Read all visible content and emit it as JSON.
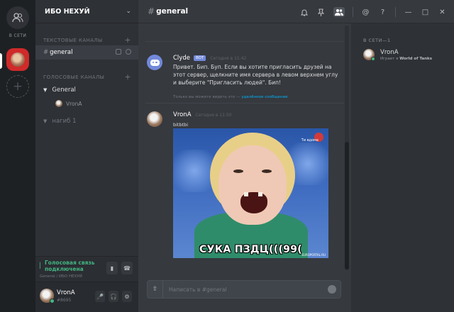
{
  "rail": {
    "online_label": "В СЕТИ",
    "add_label": "+"
  },
  "server": {
    "name": "ИБО НЕХУЙ",
    "text_category": "ТЕКСТОВЫЕ КАНАЛЫ",
    "voice_category": "ГОЛОСОВЫЕ КАНАЛЫ",
    "text_channel": "general",
    "voice_channels": [
      {
        "name": "General",
        "users": [
          "VronA"
        ]
      },
      {
        "name": "нагиб 1"
      }
    ]
  },
  "voice_panel": {
    "status": "Голосовая связь подключена",
    "location": "General / ИБО НЕХУЙ"
  },
  "user": {
    "name": "VronA",
    "tag": "#8695"
  },
  "chat": {
    "channel": "general",
    "placeholder": "Написать в #general",
    "messages": [
      {
        "author": "Clyde",
        "bot_tag": "BOT",
        "timestamp": "Сегодня в 11:42",
        "text": "Привет. Бип. Буп. Если вы хотите пригласить друзей на этот сервер, щелкните имя сервера в левом верхнем углу и выберите \"Пригласить людей\". Бип!",
        "note": "Только вы можете видеть это — ",
        "note_link": "удалённое сообщение"
      },
      {
        "author": "VronA",
        "timestamp": "Сегодня в 11:50",
        "text": "bitbtbi",
        "image_caption": "СУКА ПЗДЦ(((99(",
        "image_logo": "Ти вдома",
        "image_watermark": "EUROPORTAL.RU"
      }
    ]
  },
  "members": {
    "category": "В СЕТИ—1",
    "list": [
      {
        "name": "VronA",
        "playing_prefix": "Играет в ",
        "game": "World of Tanks"
      }
    ]
  },
  "colors": {
    "online": "#43b581",
    "blurple": "#7289da",
    "server_red": "#d02a2a"
  }
}
